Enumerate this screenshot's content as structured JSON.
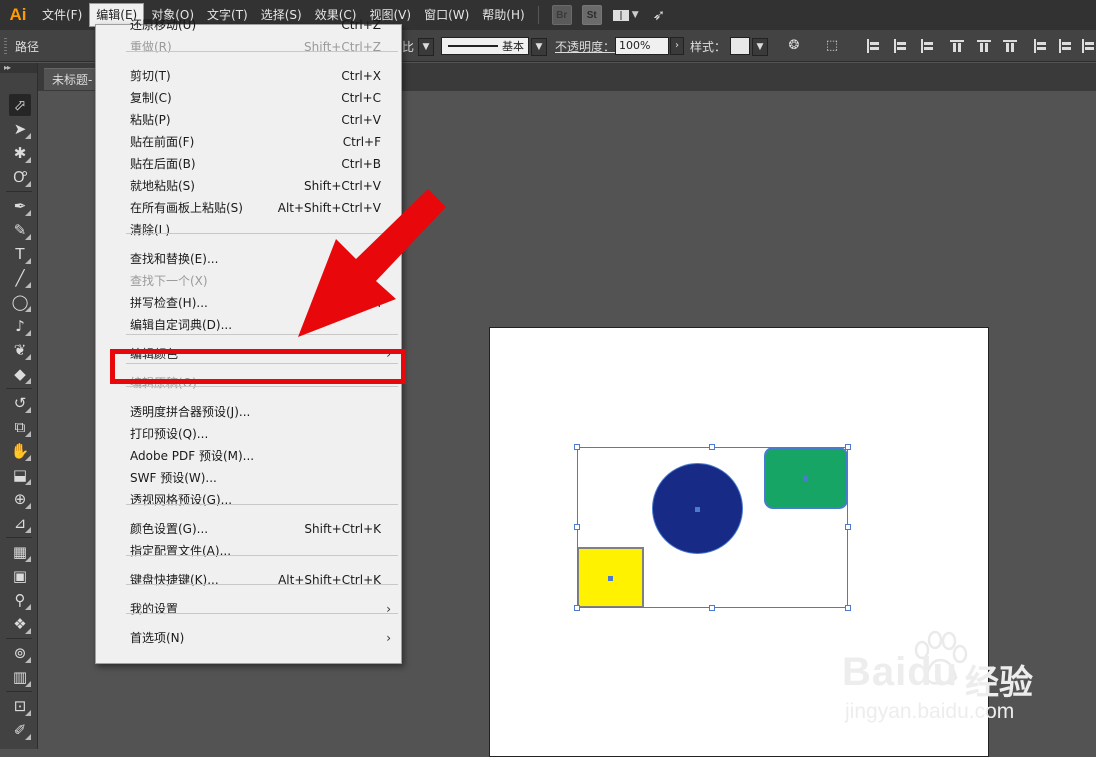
{
  "app": {
    "logo": "Ai"
  },
  "menubar": {
    "items": [
      "文件(F)",
      "编辑(E)",
      "对象(O)",
      "文字(T)",
      "选择(S)",
      "效果(C)",
      "视图(V)",
      "窗口(W)",
      "帮助(H)"
    ],
    "active_index": 1,
    "bridge_label": "Br",
    "stock_label": "St"
  },
  "controlbar": {
    "selection_label": "路径",
    "ratio_label": "比",
    "stroke_style_label": "基本",
    "opacity_label": "不透明度：",
    "opacity_value": "100%",
    "style_label": "样式："
  },
  "document": {
    "tab_title": "未标题-"
  },
  "edit_menu": {
    "items": [
      {
        "label": "还原移动(U)",
        "shortcut": "Ctrl+Z",
        "disabled": false
      },
      {
        "label": "重做(R)",
        "shortcut": "Shift+Ctrl+Z",
        "disabled": true
      },
      {
        "label": "剪切(T)",
        "shortcut": "Ctrl+X",
        "disabled": false
      },
      {
        "label": "复制(C)",
        "shortcut": "Ctrl+C",
        "disabled": false
      },
      {
        "label": "粘贴(P)",
        "shortcut": "Ctrl+V",
        "disabled": false
      },
      {
        "label": "贴在前面(F)",
        "shortcut": "Ctrl+F",
        "disabled": false
      },
      {
        "label": "贴在后面(B)",
        "shortcut": "Ctrl+B",
        "disabled": false
      },
      {
        "label": "就地粘贴(S)",
        "shortcut": "Shift+Ctrl+V",
        "disabled": false
      },
      {
        "label": "在所有画板上粘贴(S)",
        "shortcut": "Alt+Shift+Ctrl+V",
        "disabled": false
      },
      {
        "label": "清除(L)",
        "shortcut": "",
        "disabled": false
      },
      {
        "label": "查找和替换(E)...",
        "shortcut": "",
        "disabled": false
      },
      {
        "label": "查找下一个(X)",
        "shortcut": "",
        "disabled": true
      },
      {
        "label": "拼写检查(H)...",
        "shortcut": "Ctrl+I",
        "disabled": false
      },
      {
        "label": "编辑自定词典(D)...",
        "shortcut": "",
        "disabled": false
      },
      {
        "label": "编辑颜色",
        "shortcut": "",
        "disabled": false,
        "submenu": true
      },
      {
        "label": "编辑原稿(O)",
        "shortcut": "",
        "disabled": true
      },
      {
        "label": "透明度拼合器预设(J)...",
        "shortcut": "",
        "disabled": false
      },
      {
        "label": "打印预设(Q)...",
        "shortcut": "",
        "disabled": false
      },
      {
        "label": "Adobe PDF 预设(M)...",
        "shortcut": "",
        "disabled": false
      },
      {
        "label": "SWF 预设(W)...",
        "shortcut": "",
        "disabled": false
      },
      {
        "label": "透视网格预设(G)...",
        "shortcut": "",
        "disabled": false
      },
      {
        "label": "颜色设置(G)...",
        "shortcut": "Shift+Ctrl+K",
        "disabled": false
      },
      {
        "label": "指定配置文件(A)...",
        "shortcut": "",
        "disabled": false
      },
      {
        "label": "键盘快捷键(K)...",
        "shortcut": "Alt+Shift+Ctrl+K",
        "disabled": false
      },
      {
        "label": "我的设置",
        "shortcut": "",
        "disabled": false,
        "submenu": true
      },
      {
        "label": "首选项(N)",
        "shortcut": "",
        "disabled": false,
        "submenu": true
      }
    ],
    "highlighted_item": "编辑颜色"
  },
  "canvas": {
    "shapes": [
      {
        "name": "circle",
        "fill": "#172a86"
      },
      {
        "name": "rounded-rect",
        "fill": "#16a564"
      },
      {
        "name": "square",
        "fill": "#fff200"
      }
    ]
  },
  "annotation": {
    "color": "#e8080b"
  },
  "watermark": {
    "brand": "Bai",
    "brand2": "du",
    "cn": "经验",
    "url": "jingyan.baidu.com"
  }
}
